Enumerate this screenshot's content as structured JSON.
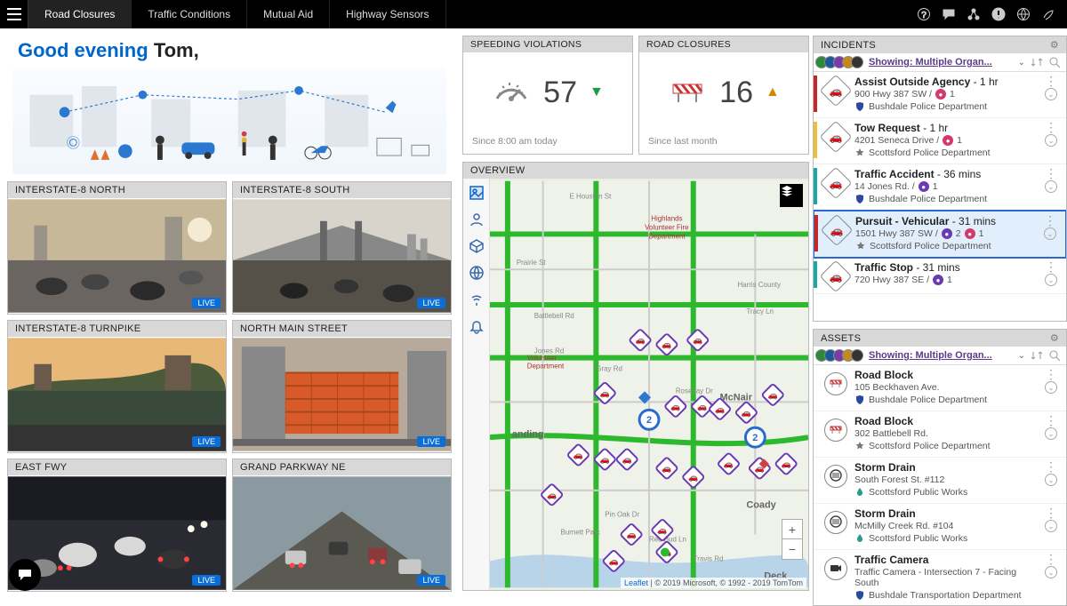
{
  "nav": {
    "tabs": [
      "Road Closures",
      "Traffic Conditions",
      "Mutual Aid",
      "Highway Sensors"
    ],
    "active": 0
  },
  "greeting": {
    "prefix": "Good evening",
    "name": "Tom,"
  },
  "cameras": [
    {
      "title": "INTERSTATE-8 NORTH",
      "live": "LIVE"
    },
    {
      "title": "INTERSTATE-8 SOUTH",
      "live": "LIVE"
    },
    {
      "title": "INTERSTATE-8 TURNPIKE",
      "live": "LIVE"
    },
    {
      "title": "NORTH MAIN STREET",
      "live": "LIVE"
    },
    {
      "title": "EAST FWY",
      "live": "LIVE"
    },
    {
      "title": "GRAND PARKWAY NE",
      "live": "LIVE"
    }
  ],
  "stats": {
    "speeding": {
      "title": "SPEEDING VIOLATIONS",
      "value": "57",
      "trend": "down",
      "note": "Since 8:00 am today"
    },
    "closures": {
      "title": "ROAD CLOSURES",
      "value": "16",
      "trend": "up",
      "note": "Since last month"
    }
  },
  "overview": {
    "title": "OVERVIEW"
  },
  "map": {
    "streets": [
      "E Houston St",
      "Prairie St",
      "Battlebell Rd",
      "Jones Rd",
      "Gray Rd",
      "Rosebay Dr",
      "Pin Oak Dr",
      "Red Bud Ln",
      "Travis Rd",
      "Burnett Park",
      "Tracy Ln",
      "Harris County"
    ],
    "places": [
      "Highlands Volunteer Fire Department",
      "McNair",
      "Coady",
      "Deck",
      "anding"
    ],
    "attrib_leaflet": "Leaflet",
    "attrib_rest": " | © 2019 Microsoft, © 1992 - 2019 TomTom"
  },
  "incidentsPanel": {
    "title": "INCIDENTS",
    "filterLabel": "Showing: Multiple Organ...",
    "items": [
      {
        "stripe": "red",
        "title": "Assist Outside Agency",
        "age": "1 hr",
        "loc": "900 Hwy 387 SW",
        "c1": "1",
        "org": "Bushdale Police Department",
        "orgIcon": "shield-blue"
      },
      {
        "stripe": "yellow",
        "title": "Tow Request",
        "age": "1 hr",
        "loc": "4201 Seneca Drive",
        "c1": "1",
        "org": "Scottsford Police Department",
        "orgIcon": "star-gray"
      },
      {
        "stripe": "teal",
        "title": "Traffic Accident",
        "age": "36 mins",
        "loc": "14 Jones Rd.",
        "c1": "1",
        "org": "Bushdale Police Department",
        "orgIcon": "shield-blue",
        "badgePurple": true
      },
      {
        "stripe": "red",
        "title": "Pursuit - Vehicular",
        "age": "31 mins",
        "loc": "1501 Hwy 387 SW",
        "c1": "2",
        "c2": "1",
        "org": "Scottsford Police Department",
        "orgIcon": "star-gray",
        "selected": true,
        "badgePurple": true
      },
      {
        "stripe": "teal",
        "title": "Traffic Stop",
        "age": "31 mins",
        "loc": "720 Hwy 387 SE",
        "c1": "1",
        "org": "",
        "badgePurple": true
      }
    ]
  },
  "assetsPanel": {
    "title": "ASSETS",
    "filterLabel": "Showing: Multiple Organ...",
    "items": [
      {
        "icon": "barrier",
        "title": "Road Block",
        "loc": "105 Beckhaven Ave.",
        "org": "Bushdale Police Department",
        "orgIcon": "shield-blue"
      },
      {
        "icon": "barrier",
        "title": "Road Block",
        "loc": "302 Battlebell Rd.",
        "org": "Scottsford Police Department",
        "orgIcon": "star-gray"
      },
      {
        "icon": "drain",
        "title": "Storm Drain",
        "loc": "South Forest St. #112",
        "org": "Scottsford Public Works",
        "orgIcon": "drop"
      },
      {
        "icon": "drain",
        "title": "Storm Drain",
        "loc": "McMilly Creek Rd. #104",
        "org": "Scottsford Public Works",
        "orgIcon": "drop"
      },
      {
        "icon": "camera",
        "title": "Traffic Camera",
        "loc": "Traffic Camera - Intersection 7 - Facing South",
        "org": "Bushdale Transportation Department",
        "orgIcon": "shield-blue"
      }
    ]
  }
}
